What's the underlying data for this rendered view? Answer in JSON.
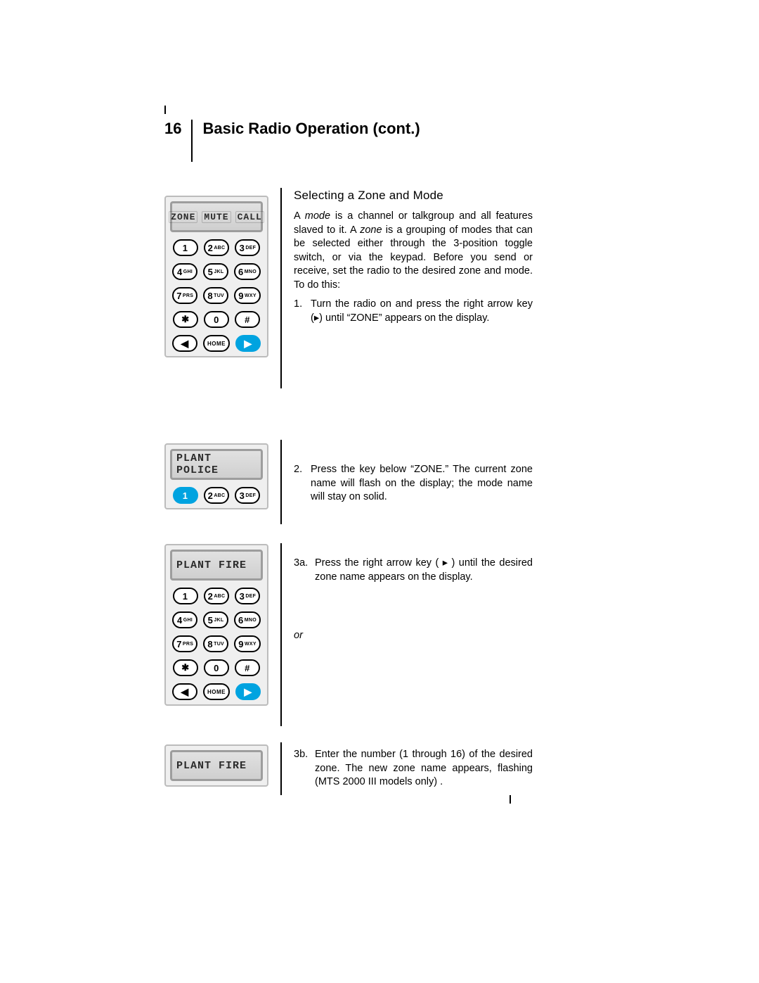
{
  "header": {
    "page_number": "16",
    "title": "Basic Radio Operation (cont.)"
  },
  "section_title": "Selecting a Zone and Mode",
  "intro": {
    "pre1": "A ",
    "mode_word": "mode",
    "mid1": " is a channel or talkgroup and all features slaved to it. A ",
    "zone_word": "zone",
    "mid2": " is a grouping of modes that can be selected either through the 3-position toggle switch, or via the keypad. Before you send or receive, set the radio to the desired zone and mode. To do this:"
  },
  "step1": {
    "num": "1.",
    "pre": "Turn the radio on and press the right arrow key (▸) until “",
    "bold": "ZONE",
    "post": "” appears on the display."
  },
  "step2": {
    "num": "2.",
    "pre": "Press the key below “",
    "bold": "ZONE",
    "post": ".” The current zone name will flash on the display; the mode name will stay on solid."
  },
  "step3a": {
    "num": "3a.",
    "text": "Press the right arrow key ( ▸ ) until the desired zone name appears on the display."
  },
  "or_label": "or",
  "step3b": {
    "num": "3b.",
    "text": "Enter the number (1 through 16) of the desired zone. The  new zone name appears, flashing (MTS 2000 III models only) ."
  },
  "lcd": {
    "zone_mute_call": [
      "ZONE",
      "MUTE",
      "CALL"
    ],
    "plant_police": "PLANT POLICE",
    "plant_fire": "PLANT FIRE"
  },
  "keys": {
    "k1": "1",
    "k2": "2",
    "k2s": "ABC",
    "k3": "3",
    "k3s": "DEF",
    "k4": "4",
    "k4s": "GHI",
    "k5": "5",
    "k5s": "JKL",
    "k6": "6",
    "k6s": "MNO",
    "k7": "7",
    "k7s": "PRS",
    "k8": "8",
    "k8s": "TUV",
    "k9": "9",
    "k9s": "WXY",
    "star": "✱",
    "k0": "0",
    "hash": "#",
    "home": "HOME",
    "left": "◀",
    "right": "▶"
  }
}
